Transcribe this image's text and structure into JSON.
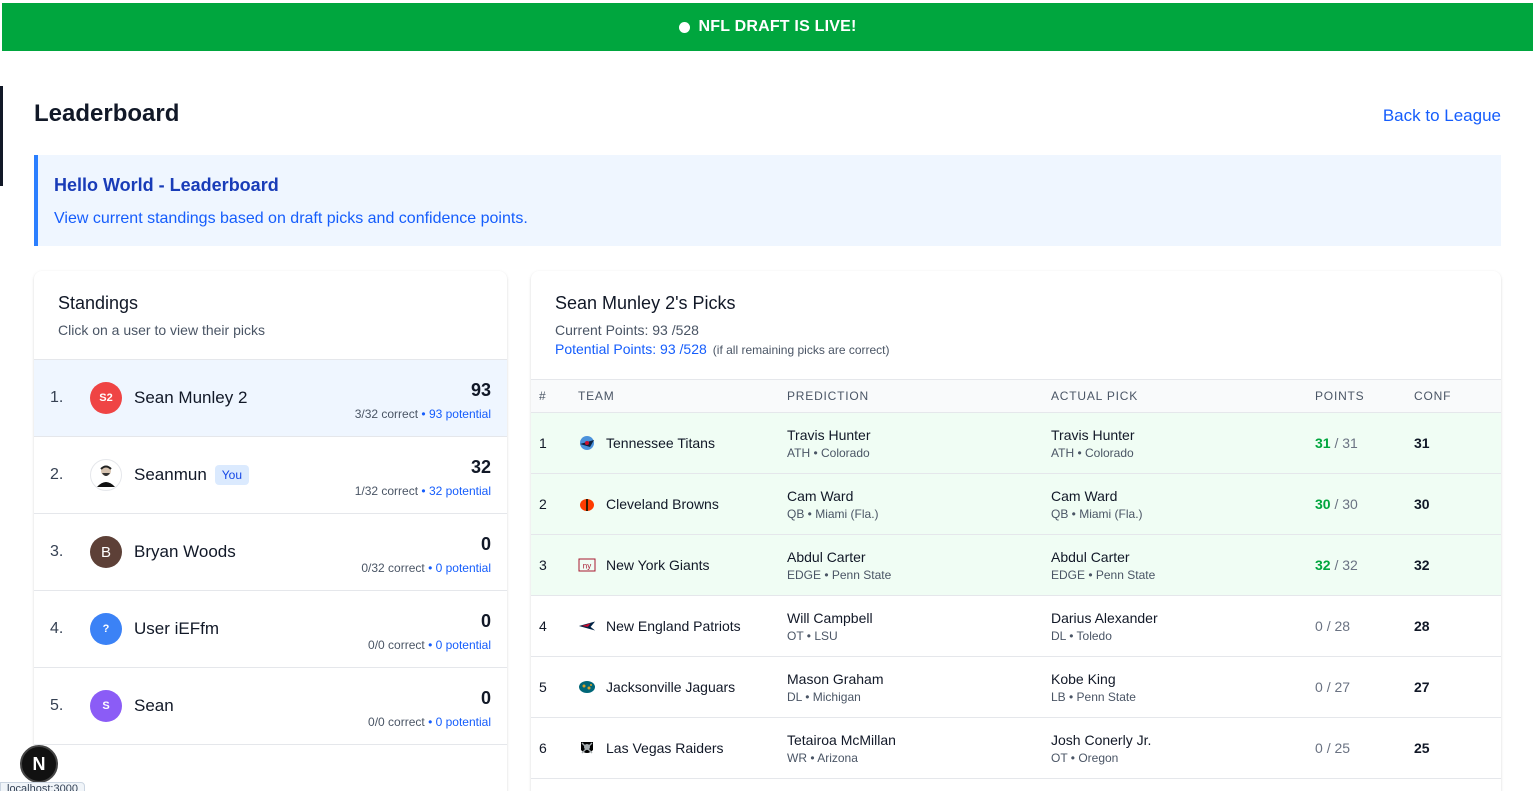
{
  "banner": {
    "text": "NFL DRAFT IS LIVE!"
  },
  "header": {
    "title": "Leaderboard",
    "back_link": "Back to League"
  },
  "info": {
    "title": "Hello World - Leaderboard",
    "text": "View current standings based on draft picks and confidence points."
  },
  "standings": {
    "title": "Standings",
    "subtitle": "Click on a user to view their picks",
    "rows": [
      {
        "rank": "1.",
        "initials": "S2",
        "avatar_color": "#ef4444",
        "name": "Sean Munley 2",
        "badge": "",
        "score": "93",
        "correct": "3/32 correct",
        "potential": "• 93 potential",
        "selected": true
      },
      {
        "rank": "2.",
        "initials": "",
        "avatar_color": "#ffffff",
        "name": "Seanmun",
        "badge": "You",
        "score": "32",
        "correct": "1/32 correct",
        "potential": "• 32 potential",
        "selected": false
      },
      {
        "rank": "3.",
        "initials": "B",
        "avatar_color": "#5d4037",
        "name": "Bryan Woods",
        "badge": "",
        "score": "0",
        "correct": "0/32 correct",
        "potential": "• 0 potential",
        "selected": false
      },
      {
        "rank": "4.",
        "initials": "?",
        "avatar_color": "#3b82f6",
        "name": "User iEFfm",
        "badge": "",
        "score": "0",
        "correct": "0/0 correct",
        "potential": "• 0 potential",
        "selected": false
      },
      {
        "rank": "5.",
        "initials": "S",
        "avatar_color": "#8b5cf6",
        "name": "Sean",
        "badge": "",
        "score": "0",
        "correct": "0/0 correct",
        "potential": "• 0 potential",
        "selected": false
      }
    ]
  },
  "picks": {
    "title": "Sean Munley 2's Picks",
    "current_points": "Current Points: 93 /528",
    "potential_points": "Potential Points: 93 /528",
    "potential_note": "(if all remaining picks are correct)",
    "columns": [
      "#",
      "TEAM",
      "PREDICTION",
      "ACTUAL PICK",
      "POINTS",
      "CONF"
    ],
    "rows": [
      {
        "num": "1",
        "team": "Tennessee Titans",
        "logo": "titans-logo-icon",
        "pred_name": "Travis Hunter",
        "pred_info": "ATH • Colorado",
        "act_name": "Travis Hunter",
        "act_info": "ATH • Colorado",
        "points": "31",
        "max": "/ 31",
        "conf": "31",
        "correct": true
      },
      {
        "num": "2",
        "team": "Cleveland Browns",
        "logo": "browns-logo-icon",
        "pred_name": "Cam Ward",
        "pred_info": "QB • Miami (Fla.)",
        "act_name": "Cam Ward",
        "act_info": "QB • Miami (Fla.)",
        "points": "30",
        "max": "/ 30",
        "conf": "30",
        "correct": true
      },
      {
        "num": "3",
        "team": "New York Giants",
        "logo": "giants-logo-icon",
        "pred_name": "Abdul Carter",
        "pred_info": "EDGE • Penn State",
        "act_name": "Abdul Carter",
        "act_info": "EDGE • Penn State",
        "points": "32",
        "max": "/ 32",
        "conf": "32",
        "correct": true
      },
      {
        "num": "4",
        "team": "New England Patriots",
        "logo": "patriots-logo-icon",
        "pred_name": "Will Campbell",
        "pred_info": "OT • LSU",
        "act_name": "Darius Alexander",
        "act_info": "DL • Toledo",
        "points": "0",
        "max": "/ 28",
        "conf": "28",
        "correct": false
      },
      {
        "num": "5",
        "team": "Jacksonville Jaguars",
        "logo": "jaguars-logo-icon",
        "pred_name": "Mason Graham",
        "pred_info": "DL • Michigan",
        "act_name": "Kobe King",
        "act_info": "LB • Penn State",
        "points": "0",
        "max": "/ 27",
        "conf": "27",
        "correct": false
      },
      {
        "num": "6",
        "team": "Las Vegas Raiders",
        "logo": "raiders-logo-icon",
        "pred_name": "Tetairoa McMillan",
        "pred_info": "WR • Arizona",
        "act_name": "Josh Conerly Jr.",
        "act_info": "OT • Oregon",
        "points": "0",
        "max": "/ 25",
        "conf": "25",
        "correct": false
      }
    ]
  },
  "devtools": {
    "button": "N",
    "url": "localhost:3000"
  },
  "colors": {
    "banner": "#00a63e",
    "accent": "#155dfc",
    "correct_row": "#f0fdf4",
    "selected_row": "#eff6ff"
  }
}
